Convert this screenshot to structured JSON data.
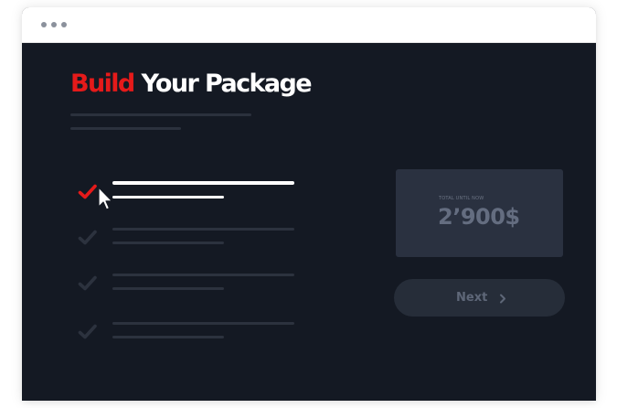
{
  "window": {
    "dots": [
      "dot-1",
      "dot-2",
      "dot-3"
    ]
  },
  "header": {
    "title_accent": "Build",
    "title_rest": "Your Package"
  },
  "options": [
    {
      "state": "selected",
      "icon": "check-icon"
    },
    {
      "state": "unselected",
      "icon": "check-icon"
    },
    {
      "state": "unselected",
      "icon": "check-icon"
    },
    {
      "state": "unselected",
      "icon": "check-icon"
    }
  ],
  "total": {
    "label": "TOTAL UNTIL NOW",
    "value": "2’900$"
  },
  "actions": {
    "next_label": "Next",
    "next_icon": "chevron-right-icon"
  },
  "colors": {
    "background": "#141923",
    "accent": "#e51a1a",
    "card": "#2a3140",
    "button": "#262d39",
    "muted_text": "#5e6778"
  }
}
